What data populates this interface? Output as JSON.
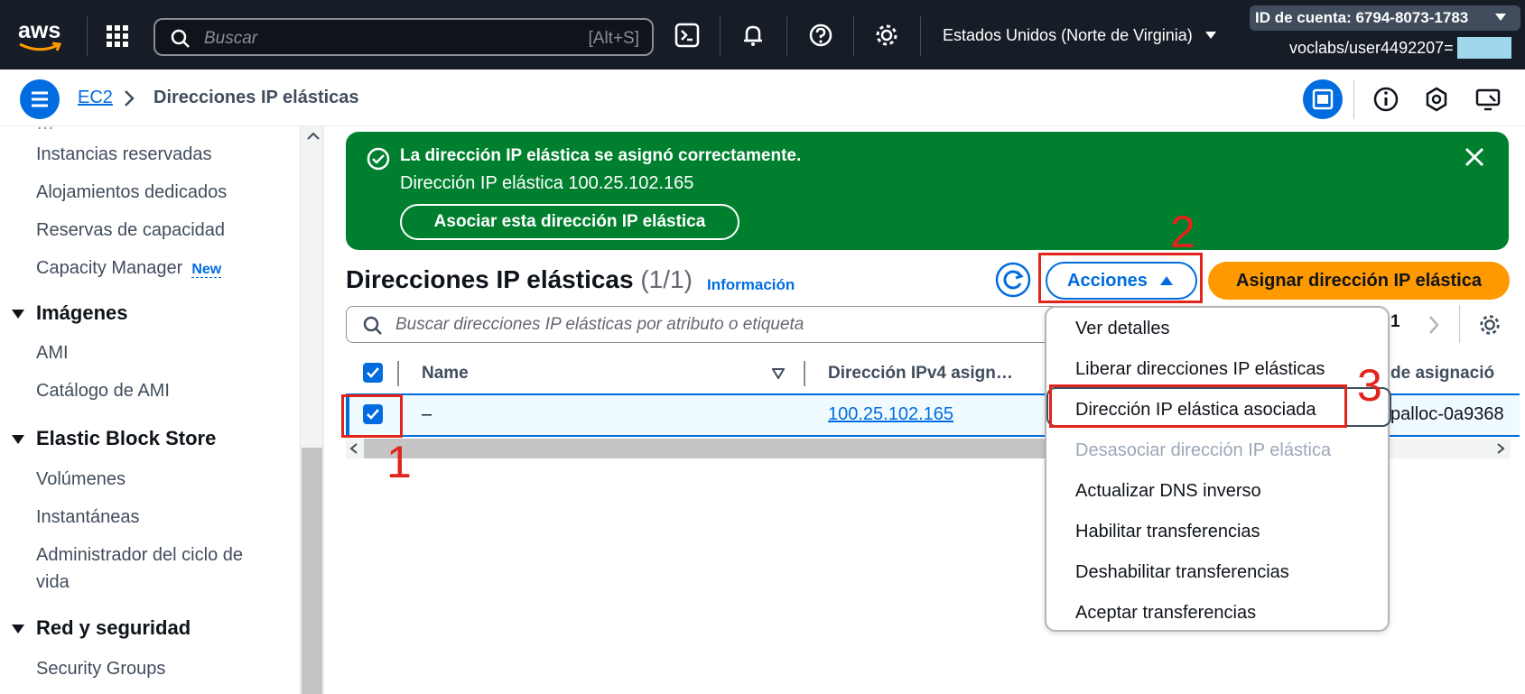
{
  "topbar": {
    "logo_text": "aws",
    "search_placeholder": "Buscar",
    "search_shortcut": "[Alt+S]",
    "region": "Estados Unidos (Norte de Virginia)",
    "account_id": "ID de cuenta: 6794-8073-1783",
    "user": "voclabs/user4492207=",
    "icons": [
      "grid-icon",
      "cloudshell-icon",
      "bell-icon",
      "help-icon",
      "gear-icon"
    ]
  },
  "breadcrumb": {
    "root": "EC2",
    "current": "Direcciones IP elásticas"
  },
  "sidebar": {
    "items": [
      {
        "type": "item",
        "label": "Instancias reservadas"
      },
      {
        "type": "item",
        "label": "Alojamientos dedicados"
      },
      {
        "type": "item",
        "label": "Reservas de capacidad"
      },
      {
        "type": "item",
        "label": "Capacity Manager",
        "badge": "New"
      },
      {
        "type": "section",
        "label": "Imágenes"
      },
      {
        "type": "item",
        "label": "AMI"
      },
      {
        "type": "item",
        "label": "Catálogo de AMI"
      },
      {
        "type": "section",
        "label": "Elastic Block Store"
      },
      {
        "type": "item",
        "label": "Volúmenes"
      },
      {
        "type": "item",
        "label": "Instantáneas"
      },
      {
        "type": "item",
        "label": "Administrador del ciclo de"
      },
      {
        "type": "item",
        "label": "vida"
      },
      {
        "type": "section",
        "label": "Red y seguridad"
      },
      {
        "type": "item",
        "label": "Security Groups"
      }
    ]
  },
  "flash": {
    "title": "La dirección IP elástica se asignó correctamente.",
    "message": "Dirección IP elástica 100.25.102.165",
    "button": "Asociar esta dirección IP elástica",
    "color": "#00802f"
  },
  "main": {
    "title": "Direcciones IP elásticas",
    "count": "(1/1)",
    "info": "Información",
    "actions_label": "Acciones",
    "allocate_label": "Asignar dirección IP elástica",
    "filter_placeholder": "Buscar direcciones IP elásticas por atributo o etiqueta",
    "page": "1",
    "columns": [
      "Name",
      "Dirección IPv4 asign…",
      "de asignació"
    ],
    "rows": [
      {
        "name": "–",
        "ip": "100.25.102.165",
        "alloc": "palloc-0a9368"
      }
    ]
  },
  "menu": {
    "items": [
      {
        "label": "Ver detalles",
        "disabled": false
      },
      {
        "label": "Liberar direcciones IP elásticas",
        "disabled": false
      },
      {
        "label": "Dirección IP elástica asociada",
        "disabled": false
      },
      {
        "label": "Desasociar dirección IP elástica",
        "disabled": true
      },
      {
        "label": "Actualizar DNS inverso",
        "disabled": false
      },
      {
        "label": "Habilitar transferencias",
        "disabled": false
      },
      {
        "label": "Deshabilitar transferencias",
        "disabled": false
      },
      {
        "label": "Aceptar transferencias",
        "disabled": false
      }
    ]
  },
  "annotations": [
    "1",
    "2",
    "3"
  ],
  "colors": {
    "accent": "#006ce0",
    "allocate": "#ff9900",
    "annotation": "#e1251b",
    "topbar": "#161d26"
  }
}
